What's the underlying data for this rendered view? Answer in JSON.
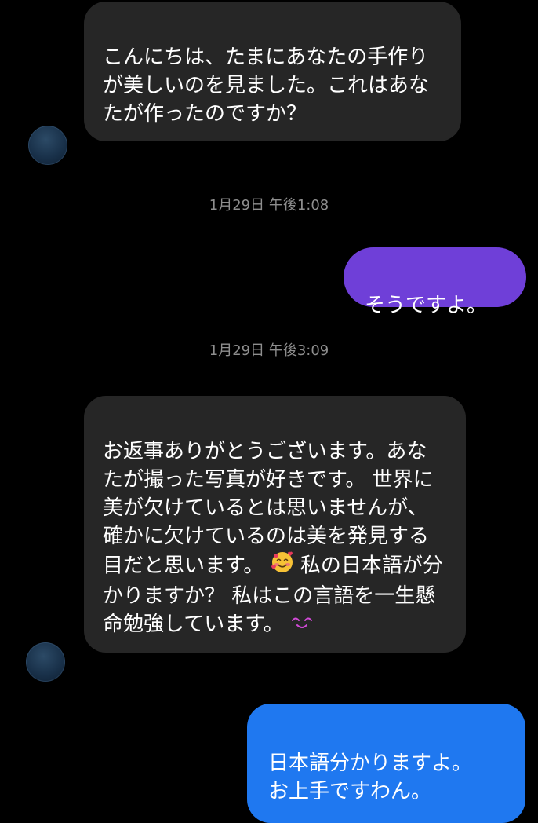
{
  "messages": [
    {
      "type": "incoming",
      "text": "こんにちは、たまにあなたの手作りが美しいのを見ました。これはあなたが作ったのですか？"
    },
    {
      "type": "timestamp",
      "text": "1月29日 午後1:08"
    },
    {
      "type": "outgoing",
      "text": "そうですよ。",
      "color": "#6f3fd8"
    },
    {
      "type": "timestamp",
      "text": "1月29日 午後3:09"
    },
    {
      "type": "incoming",
      "text_a": "お返事ありがとうございます。あなたが撮った写真が好きです。 世界に美が欠けているとは思いませんが、確かに欠けているのは美を発見する目だと思います。 ",
      "emoji_a": "smiling-face-with-hearts-icon",
      "text_b": " 私の日本語が分かりますか？ 私はこの言語を一生懸命勉強しています。 ",
      "emoji_b": "smiling-eyes-icon"
    },
    {
      "type": "outgoing",
      "text": "日本語分かりますよ。\nお上手ですわん。",
      "color": "#1f78f0"
    }
  ],
  "colors": {
    "background": "#000000",
    "incoming_bubble": "#262626",
    "timestamp_text": "#8e8e8e",
    "outgoing_purple": "#6f3fd8",
    "outgoing_blue": "#1f78f0"
  }
}
